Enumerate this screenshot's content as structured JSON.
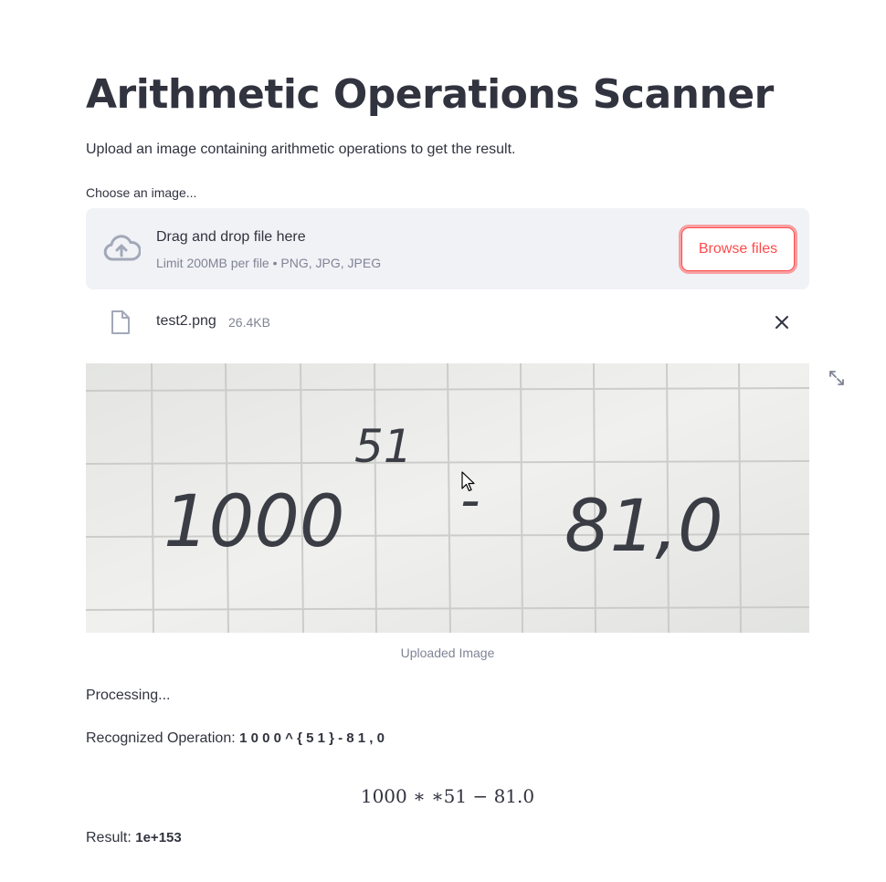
{
  "header": {
    "title": "Arithmetic Operations Scanner",
    "subtitle": "Upload an image containing arithmetic operations to get the result."
  },
  "uploader": {
    "label": "Choose an image...",
    "drag_text": "Drag and drop file here",
    "limit_text": "Limit 200MB per file • PNG, JPG, JPEG",
    "browse_label": "Browse files",
    "file": {
      "name": "test2.png",
      "size": "26.4KB"
    }
  },
  "image": {
    "caption": "Uploaded Image",
    "handwritten": {
      "base": "1000",
      "exponent": "51",
      "operator": "-",
      "operand": "81,0"
    }
  },
  "output": {
    "status": "Processing...",
    "recognized_label": "Recognized Operation:",
    "recognized_value": "1 0 0 0 ^ { 5 1 } - 8 1 , 0",
    "formula": "1000 ∗ ∗51 − 81.0",
    "result_label": "Result:",
    "result_value": "1e+153"
  },
  "colors": {
    "accent": "#ff4b4b",
    "text": "#31333f",
    "muted": "#808495",
    "dropzone_bg": "#f0f2f6"
  },
  "icons": {
    "upload": "cloud-upload-icon",
    "file": "file-icon",
    "close": "close-icon",
    "fullscreen": "fullscreen-icon"
  }
}
